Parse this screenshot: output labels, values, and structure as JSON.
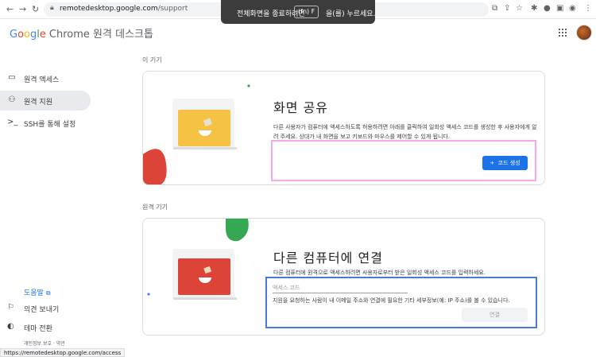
{
  "browser": {
    "url_host": "remotedesktop.google.com",
    "url_path": "/support",
    "fullscreen_banner": {
      "before": "전체화면을 종료하려면",
      "key": "(fn) F",
      "after": "을(를) 누르세요."
    }
  },
  "header": {
    "logo_g": "G",
    "logo_o1": "o",
    "logo_o2": "o",
    "logo_g2": "g",
    "logo_l": "l",
    "logo_e": "e",
    "product": "Chrome 원격 데스크톱"
  },
  "sidebar": {
    "items": [
      {
        "label": "원격 액세스",
        "icon": "laptop-icon"
      },
      {
        "label": "원격 지원",
        "icon": "people-icon"
      },
      {
        "label": "SSH를 통해 설정",
        "icon": "terminal-icon"
      }
    ],
    "help": "도움말",
    "feedback": "의견 보내기",
    "theme": "테마 전환",
    "footer": "개인정보 보호 · 약관"
  },
  "status_url": "https://remotedesktop.google.com/access",
  "this_device": {
    "section_label": "이 기기",
    "title": "화면 공유",
    "description": "다른 사용자가 컴퓨터에 액세스하도록 허용하려면 아래를 클릭하여 일회성 액세스 코드를 생성한 후 사용자에게 알려 주세요. 상대가 내 화면을 보고 키보드와 마우스를 제어할 수 있게 됩니다.",
    "button_icon": "+",
    "button_label": "코드 생성"
  },
  "remote_device": {
    "section_label": "원격 기기",
    "title": "다른 컴퓨터에 연결",
    "description": "다른 컴퓨터에 원격으로 액세스하려면 사용자로부터 받은 일회성 액세스 코드를 입력하세요.",
    "input_placeholder": "액세스 코드",
    "input_value": "",
    "hint": "지원을 요청하는 사람이 내 이메일 주소와 연결에 필요한 기타 세부정보(예: IP 주소)를 볼 수 있습니다.",
    "connect_label": "연결"
  },
  "colors": {
    "accent": "#1a73e8",
    "highlight_pink": "#f6a8e8",
    "highlight_blue": "#4b79d9"
  }
}
